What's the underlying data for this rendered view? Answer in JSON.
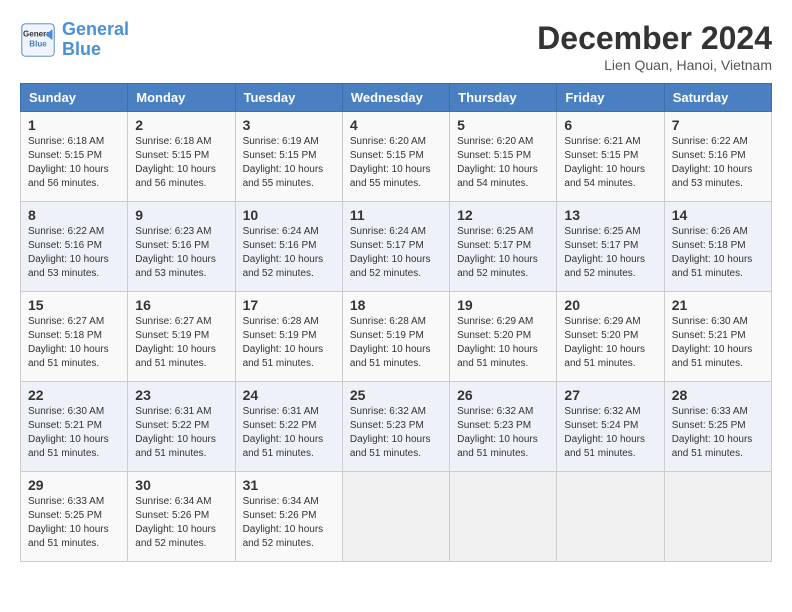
{
  "header": {
    "logo_line1": "General",
    "logo_line2": "Blue",
    "month": "December 2024",
    "location": "Lien Quan, Hanoi, Vietnam"
  },
  "days_of_week": [
    "Sunday",
    "Monday",
    "Tuesday",
    "Wednesday",
    "Thursday",
    "Friday",
    "Saturday"
  ],
  "weeks": [
    [
      {
        "day": "1",
        "info": "Sunrise: 6:18 AM\nSunset: 5:15 PM\nDaylight: 10 hours\nand 56 minutes."
      },
      {
        "day": "2",
        "info": "Sunrise: 6:18 AM\nSunset: 5:15 PM\nDaylight: 10 hours\nand 56 minutes."
      },
      {
        "day": "3",
        "info": "Sunrise: 6:19 AM\nSunset: 5:15 PM\nDaylight: 10 hours\nand 55 minutes."
      },
      {
        "day": "4",
        "info": "Sunrise: 6:20 AM\nSunset: 5:15 PM\nDaylight: 10 hours\nand 55 minutes."
      },
      {
        "day": "5",
        "info": "Sunrise: 6:20 AM\nSunset: 5:15 PM\nDaylight: 10 hours\nand 54 minutes."
      },
      {
        "day": "6",
        "info": "Sunrise: 6:21 AM\nSunset: 5:15 PM\nDaylight: 10 hours\nand 54 minutes."
      },
      {
        "day": "7",
        "info": "Sunrise: 6:22 AM\nSunset: 5:16 PM\nDaylight: 10 hours\nand 53 minutes."
      }
    ],
    [
      {
        "day": "8",
        "info": "Sunrise: 6:22 AM\nSunset: 5:16 PM\nDaylight: 10 hours\nand 53 minutes."
      },
      {
        "day": "9",
        "info": "Sunrise: 6:23 AM\nSunset: 5:16 PM\nDaylight: 10 hours\nand 53 minutes."
      },
      {
        "day": "10",
        "info": "Sunrise: 6:24 AM\nSunset: 5:16 PM\nDaylight: 10 hours\nand 52 minutes."
      },
      {
        "day": "11",
        "info": "Sunrise: 6:24 AM\nSunset: 5:17 PM\nDaylight: 10 hours\nand 52 minutes."
      },
      {
        "day": "12",
        "info": "Sunrise: 6:25 AM\nSunset: 5:17 PM\nDaylight: 10 hours\nand 52 minutes."
      },
      {
        "day": "13",
        "info": "Sunrise: 6:25 AM\nSunset: 5:17 PM\nDaylight: 10 hours\nand 52 minutes."
      },
      {
        "day": "14",
        "info": "Sunrise: 6:26 AM\nSunset: 5:18 PM\nDaylight: 10 hours\nand 51 minutes."
      }
    ],
    [
      {
        "day": "15",
        "info": "Sunrise: 6:27 AM\nSunset: 5:18 PM\nDaylight: 10 hours\nand 51 minutes."
      },
      {
        "day": "16",
        "info": "Sunrise: 6:27 AM\nSunset: 5:19 PM\nDaylight: 10 hours\nand 51 minutes."
      },
      {
        "day": "17",
        "info": "Sunrise: 6:28 AM\nSunset: 5:19 PM\nDaylight: 10 hours\nand 51 minutes."
      },
      {
        "day": "18",
        "info": "Sunrise: 6:28 AM\nSunset: 5:19 PM\nDaylight: 10 hours\nand 51 minutes."
      },
      {
        "day": "19",
        "info": "Sunrise: 6:29 AM\nSunset: 5:20 PM\nDaylight: 10 hours\nand 51 minutes."
      },
      {
        "day": "20",
        "info": "Sunrise: 6:29 AM\nSunset: 5:20 PM\nDaylight: 10 hours\nand 51 minutes."
      },
      {
        "day": "21",
        "info": "Sunrise: 6:30 AM\nSunset: 5:21 PM\nDaylight: 10 hours\nand 51 minutes."
      }
    ],
    [
      {
        "day": "22",
        "info": "Sunrise: 6:30 AM\nSunset: 5:21 PM\nDaylight: 10 hours\nand 51 minutes."
      },
      {
        "day": "23",
        "info": "Sunrise: 6:31 AM\nSunset: 5:22 PM\nDaylight: 10 hours\nand 51 minutes."
      },
      {
        "day": "24",
        "info": "Sunrise: 6:31 AM\nSunset: 5:22 PM\nDaylight: 10 hours\nand 51 minutes."
      },
      {
        "day": "25",
        "info": "Sunrise: 6:32 AM\nSunset: 5:23 PM\nDaylight: 10 hours\nand 51 minutes."
      },
      {
        "day": "26",
        "info": "Sunrise: 6:32 AM\nSunset: 5:23 PM\nDaylight: 10 hours\nand 51 minutes."
      },
      {
        "day": "27",
        "info": "Sunrise: 6:32 AM\nSunset: 5:24 PM\nDaylight: 10 hours\nand 51 minutes."
      },
      {
        "day": "28",
        "info": "Sunrise: 6:33 AM\nSunset: 5:25 PM\nDaylight: 10 hours\nand 51 minutes."
      }
    ],
    [
      {
        "day": "29",
        "info": "Sunrise: 6:33 AM\nSunset: 5:25 PM\nDaylight: 10 hours\nand 51 minutes."
      },
      {
        "day": "30",
        "info": "Sunrise: 6:34 AM\nSunset: 5:26 PM\nDaylight: 10 hours\nand 52 minutes."
      },
      {
        "day": "31",
        "info": "Sunrise: 6:34 AM\nSunset: 5:26 PM\nDaylight: 10 hours\nand 52 minutes."
      },
      {
        "day": "",
        "info": ""
      },
      {
        "day": "",
        "info": ""
      },
      {
        "day": "",
        "info": ""
      },
      {
        "day": "",
        "info": ""
      }
    ]
  ]
}
